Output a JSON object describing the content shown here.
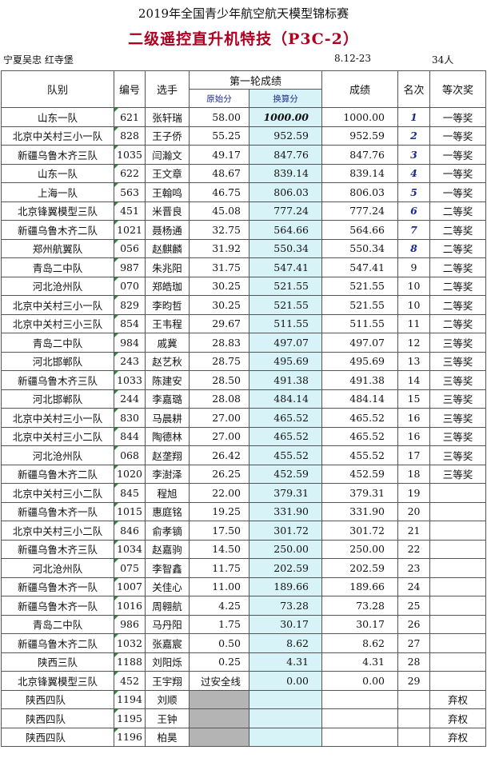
{
  "header": {
    "title": "2019年全国青少年航空航天模型锦标赛",
    "subtitle": "二级遥控直升机特技（P3C-2）",
    "referees": "宁夏吴忠 红寺堡",
    "date": "8.12-23",
    "count": "34人"
  },
  "columns": {
    "team": "队别",
    "number": "编号",
    "player": "选手",
    "round1": "第一轮成绩",
    "raw": "原始分",
    "converted": "换算分",
    "score": "成绩",
    "rank": "名次",
    "award": "等次奖"
  },
  "rows": [
    {
      "team": "山东一队",
      "num": "621",
      "name": "张轩瑞",
      "raw": "58.00",
      "conv": "1000.00",
      "score": "1000.00",
      "rank": "1",
      "award": "一等奖"
    },
    {
      "team": "北京中关村三小一队",
      "num": "828",
      "name": "王子侨",
      "raw": "55.25",
      "conv": "952.59",
      "score": "952.59",
      "rank": "2",
      "award": "一等奖"
    },
    {
      "team": "新疆乌鲁木齐三队",
      "num": "1035",
      "name": "闫瀚文",
      "raw": "49.17",
      "conv": "847.76",
      "score": "847.76",
      "rank": "3",
      "award": "一等奖"
    },
    {
      "team": "山东一队",
      "num": "622",
      "name": "王文章",
      "raw": "48.67",
      "conv": "839.14",
      "score": "839.14",
      "rank": "4",
      "award": "一等奖"
    },
    {
      "team": "上海一队",
      "num": "563",
      "name": "王翰鸣",
      "raw": "46.75",
      "conv": "806.03",
      "score": "806.03",
      "rank": "5",
      "award": "一等奖"
    },
    {
      "team": "北京锋翼模型三队",
      "num": "451",
      "name": "米晋良",
      "raw": "45.08",
      "conv": "777.24",
      "score": "777.24",
      "rank": "6",
      "award": "二等奖"
    },
    {
      "team": "新疆乌鲁木齐二队",
      "num": "1021",
      "name": "聂杨通",
      "raw": "32.75",
      "conv": "564.66",
      "score": "564.66",
      "rank": "7",
      "award": "二等奖"
    },
    {
      "team": "郑州航翼队",
      "num": "056",
      "name": "赵麒麟",
      "raw": "31.92",
      "conv": "550.34",
      "score": "550.34",
      "rank": "8",
      "award": "二等奖"
    },
    {
      "team": "青岛二中队",
      "num": "987",
      "name": "朱兆阳",
      "raw": "31.75",
      "conv": "547.41",
      "score": "547.41",
      "rank": "9",
      "award": "二等奖"
    },
    {
      "team": "河北沧州队",
      "num": "070",
      "name": "郑皓珈",
      "raw": "30.25",
      "conv": "521.55",
      "score": "521.55",
      "rank": "10",
      "award": "二等奖"
    },
    {
      "team": "北京中关村三小一队",
      "num": "829",
      "name": "李昀哲",
      "raw": "30.25",
      "conv": "521.55",
      "score": "521.55",
      "rank": "10",
      "award": "二等奖"
    },
    {
      "team": "北京中关村三小三队",
      "num": "854",
      "name": "王韦程",
      "raw": "29.67",
      "conv": "511.55",
      "score": "511.55",
      "rank": "11",
      "award": "二等奖"
    },
    {
      "team": "青岛二中队",
      "num": "984",
      "name": "戚冀",
      "raw": "28.83",
      "conv": "497.07",
      "score": "497.07",
      "rank": "12",
      "award": "三等奖"
    },
    {
      "team": "河北邯郸队",
      "num": "243",
      "name": "赵艺秋",
      "raw": "28.75",
      "conv": "495.69",
      "score": "495.69",
      "rank": "13",
      "award": "三等奖"
    },
    {
      "team": "新疆乌鲁木齐三队",
      "num": "1033",
      "name": "陈建安",
      "raw": "28.50",
      "conv": "491.38",
      "score": "491.38",
      "rank": "14",
      "award": "三等奖"
    },
    {
      "team": "河北邯郸队",
      "num": "244",
      "name": "李嘉璐",
      "raw": "28.08",
      "conv": "484.14",
      "score": "484.14",
      "rank": "15",
      "award": "三等奖"
    },
    {
      "team": "北京中关村三小一队",
      "num": "830",
      "name": "马晨耕",
      "raw": "27.00",
      "conv": "465.52",
      "score": "465.52",
      "rank": "16",
      "award": "三等奖"
    },
    {
      "team": "北京中关村三小二队",
      "num": "844",
      "name": "陶德林",
      "raw": "27.00",
      "conv": "465.52",
      "score": "465.52",
      "rank": "16",
      "award": "三等奖"
    },
    {
      "team": "河北沧州队",
      "num": "068",
      "name": "赵垄翔",
      "raw": "26.42",
      "conv": "455.52",
      "score": "455.52",
      "rank": "17",
      "award": "三等奖"
    },
    {
      "team": "新疆乌鲁木齐二队",
      "num": "1020",
      "name": "李澍泽",
      "raw": "26.25",
      "conv": "452.59",
      "score": "452.59",
      "rank": "18",
      "award": "三等奖"
    },
    {
      "team": "北京中关村三小二队",
      "num": "845",
      "name": "程旭",
      "raw": "22.00",
      "conv": "379.31",
      "score": "379.31",
      "rank": "19",
      "award": ""
    },
    {
      "team": "新疆乌鲁木齐一队",
      "num": "1015",
      "name": "惠庭铭",
      "raw": "19.25",
      "conv": "331.90",
      "score": "331.90",
      "rank": "20",
      "award": ""
    },
    {
      "team": "北京中关村三小二队",
      "num": "846",
      "name": "俞孝镝",
      "raw": "17.50",
      "conv": "301.72",
      "score": "301.72",
      "rank": "21",
      "award": ""
    },
    {
      "team": "新疆乌鲁木齐三队",
      "num": "1034",
      "name": "赵嘉驹",
      "raw": "14.50",
      "conv": "250.00",
      "score": "250.00",
      "rank": "22",
      "award": ""
    },
    {
      "team": "河北沧州队",
      "num": "075",
      "name": "李智鑫",
      "raw": "11.75",
      "conv": "202.59",
      "score": "202.59",
      "rank": "23",
      "award": ""
    },
    {
      "team": "新疆乌鲁木齐一队",
      "num": "1007",
      "name": "关佳心",
      "raw": "11.00",
      "conv": "189.66",
      "score": "189.66",
      "rank": "24",
      "award": ""
    },
    {
      "team": "新疆乌鲁木齐一队",
      "num": "1016",
      "name": "周翱航",
      "raw": "4.25",
      "conv": "73.28",
      "score": "73.28",
      "rank": "25",
      "award": ""
    },
    {
      "team": "青岛二中队",
      "num": "986",
      "name": "马丹阳",
      "raw": "1.75",
      "conv": "30.17",
      "score": "30.17",
      "rank": "26",
      "award": ""
    },
    {
      "team": "新疆乌鲁木齐二队",
      "num": "1032",
      "name": "张嘉宸",
      "raw": "0.50",
      "conv": "8.62",
      "score": "8.62",
      "rank": "27",
      "award": ""
    },
    {
      "team": "陕西三队",
      "num": "1188",
      "name": "刘阳烁",
      "raw": "0.25",
      "conv": "4.31",
      "score": "4.31",
      "rank": "28",
      "award": ""
    },
    {
      "team": "北京锋翼模型三队",
      "num": "452",
      "name": "王宇翔",
      "raw": "过安全线",
      "conv": "0.00",
      "score": "0.00",
      "rank": "29",
      "award": ""
    },
    {
      "team": "陕西四队",
      "num": "1194",
      "name": "刘顺",
      "raw": "",
      "conv": "",
      "score": "",
      "rank": "",
      "award": "弃权",
      "withdrawn": true
    },
    {
      "team": "陕西四队",
      "num": "1195",
      "name": "王钟",
      "raw": "",
      "conv": "",
      "score": "",
      "rank": "",
      "award": "弃权",
      "withdrawn": true
    },
    {
      "team": "陕西四队",
      "num": "1196",
      "name": "柏昊",
      "raw": "",
      "conv": "",
      "score": "",
      "rank": "",
      "award": "弃权",
      "withdrawn": true
    }
  ]
}
